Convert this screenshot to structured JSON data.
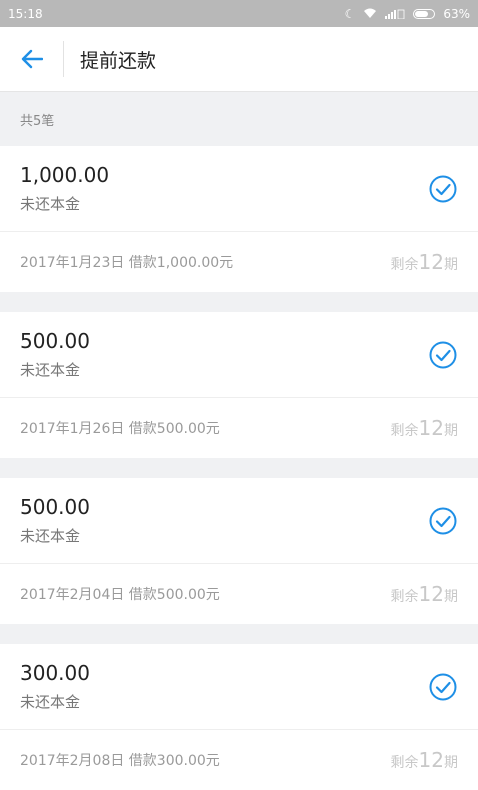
{
  "status": {
    "time": "15:18",
    "battery": "63%"
  },
  "header": {
    "title": "提前还款"
  },
  "list": {
    "count_label": "共5笔",
    "loans": [
      {
        "amount": "1,000.00",
        "amount_label": "未还本金",
        "desc": "2017年1月23日 借款1,000.00元",
        "remain_prefix": "剩余",
        "remain_num": "12",
        "remain_suffix": "期"
      },
      {
        "amount": "500.00",
        "amount_label": "未还本金",
        "desc": "2017年1月26日 借款500.00元",
        "remain_prefix": "剩余",
        "remain_num": "12",
        "remain_suffix": "期"
      },
      {
        "amount": "500.00",
        "amount_label": "未还本金",
        "desc": "2017年2月04日 借款500.00元",
        "remain_prefix": "剩余",
        "remain_num": "12",
        "remain_suffix": "期"
      },
      {
        "amount": "300.00",
        "amount_label": "未还本金",
        "desc": "2017年2月08日 借款300.00元",
        "remain_prefix": "剩余",
        "remain_num": "12",
        "remain_suffix": "期"
      }
    ]
  },
  "icons": {
    "back": "arrow-left-icon",
    "check": "check-circle-icon"
  },
  "colors": {
    "accent": "#1e8fe6",
    "statusbar": "#b8b8b8"
  }
}
